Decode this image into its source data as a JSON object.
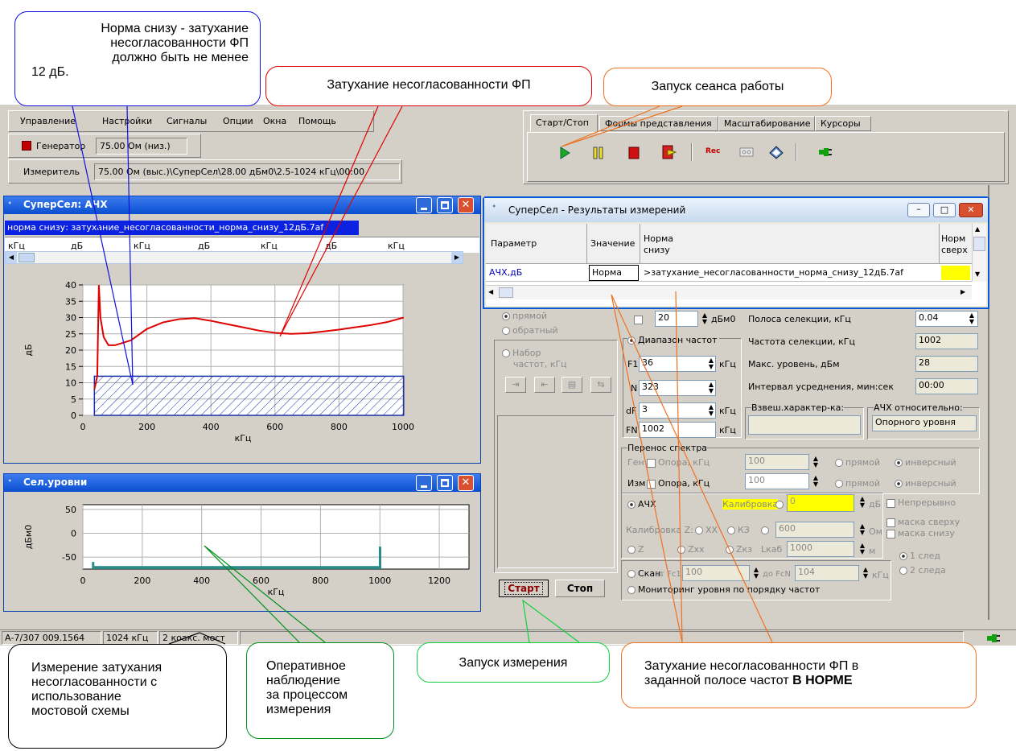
{
  "callouts": {
    "norm_below": [
      "Норма снизу - затухание",
      "несогласованности ФП",
      "должно быть не менее",
      "12 дБ."
    ],
    "attenuation": "Затухание несогласованности ФП",
    "session_start": "Запуск сеанса работы",
    "bridge_measure": [
      "Измерение затухания",
      "несогласованности с",
      "использование",
      "мостовой схемы"
    ],
    "observation": [
      "Оперативное",
      "наблюдение",
      "за процессом",
      "измерения"
    ],
    "measure_start": "Запуск измерения",
    "in_norm_prefix": "Затухание несогласованности ФП в",
    "in_norm_mid": "заданной полосе частот ",
    "in_norm_bold": "В НОРМЕ"
  },
  "menu": [
    "Управление",
    "Настройки",
    "Сигналы",
    "Опции",
    "Окна",
    "Помощь"
  ],
  "generator": {
    "label": "Генератор",
    "value": "75.00 Ом (низ.)"
  },
  "meter": {
    "label": "Измеритель",
    "value": "75.00 Ом (выс.)\\СуперСел\\28.00 дБм0\\2.5-1024 кГц\\00:00"
  },
  "tabs": [
    "Старт/Стоп",
    "Формы представления",
    "Масштабирование",
    "Курсоры"
  ],
  "toolbar_icons": [
    "play-icon",
    "pause-icon",
    "stop-icon",
    "exit-icon",
    "record-icon",
    "tape-icon",
    "eraser-icon",
    "plug-icon"
  ],
  "rec_label": "Rec",
  "ach_window": {
    "title": "СуперСел: АЧХ",
    "selected_line": "норма снизу: затухание_несогласованности_норма_снизу_12дБ.7af",
    "scroll_headers": [
      "кГц",
      "дБ",
      "кГц",
      "дБ",
      "кГц",
      "дБ",
      "кГц"
    ],
    "ylabel": "дБ",
    "xlabel": "кГц"
  },
  "sel_window": {
    "title": "Сел.уровни",
    "ylabel": "дБм0",
    "xlabel": "кГц"
  },
  "results": {
    "title": "СуперСел - Результаты измерений",
    "col_param": "Параметр",
    "col_value": "Значение",
    "col_norm_below_1": "Норма",
    "col_norm_below_2": "снизу",
    "col_norm_above_1": "Норм",
    "col_norm_above_2": "сверх",
    "row_param": "АЧХ,дБ",
    "row_value": "Норма",
    "row_norm": ">затухание_несогласованности_норма_снизу_12дБ.7af"
  },
  "panel": {
    "direct": "прямой",
    "reverse": "обратный",
    "freq_set_1": "Набор",
    "freq_set_2": "частот, кГц",
    "level": "20",
    "level_unit": "дБм0",
    "freq_range": "Диапазон частот",
    "f1_label": "F1",
    "f1": "36",
    "n_label": "N",
    "n": "323",
    "df_label": "dF",
    "df": "3",
    "fn_label": "FN",
    "fn": "1002",
    "khz": "кГц",
    "sel_band_label": "Полоса селекции, кГц",
    "sel_band": "0.04",
    "sel_freq_label": "Частота селекции, кГц",
    "sel_freq": "1002",
    "max_level_label": "Макс. уровень, дБм",
    "max_level": "28",
    "avg_label": "Интервал усреднения, мин:сек",
    "avg": "00:00",
    "weight_label": "Взвеш.характер-ка:",
    "relative_label": "АЧХ относительно:",
    "relative_value": "Опорного уровня",
    "transfer_title": "Перенос спектра",
    "gen": "Ген",
    "meas": "Изм",
    "ref_khz": "Опора, кГц",
    "ref1": "100",
    "ref2": "100",
    "inverse": "инверсный",
    "ach": "АЧХ",
    "calibration": "Калибровка",
    "calib_value": "0",
    "db": "дБ",
    "continuous": "Непрерывно",
    "mask_above": "маска сверху",
    "mask_below": "маска снизу",
    "calib_z": "Калибровка Z:",
    "xx": "ХХ",
    "kz": "КЗ",
    "calib_z_value": "600",
    "ohm": "Ом",
    "z": "Z",
    "zxx": "Zxx",
    "zkz": "Zкз",
    "lkab": "Lкаб",
    "lkab_value": "1000",
    "m": "м",
    "trace1": "1 след",
    "trace2": "2 следа",
    "scan": "Скан.",
    "from_fc1": "от Fc1",
    "fc1": "100",
    "to_fcn": "до FcN",
    "fcn": "104",
    "monitoring": "Мониторинг  уровня по порядку частот",
    "start": "Старт",
    "stop": "Стоп"
  },
  "status": [
    "А-7/307 009.1564",
    "1024 кГц",
    "2 коакс. мост"
  ],
  "chart_data": [
    {
      "type": "line",
      "title": "",
      "xlabel": "кГц",
      "ylabel": "дБ",
      "xlim": [
        0,
        1000
      ],
      "ylim": [
        0,
        40
      ],
      "xticks": [
        0,
        200,
        400,
        600,
        800,
        1000
      ],
      "yticks": [
        0,
        5,
        10,
        15,
        20,
        25,
        30,
        35,
        40
      ],
      "grid": true,
      "series": [
        {
          "name": "",
          "color": "#e00000",
          "x": [
            36,
            45,
            50,
            55,
            65,
            80,
            100,
            150,
            200,
            250,
            300,
            350,
            400,
            450,
            500,
            550,
            600,
            650,
            700,
            750,
            800,
            850,
            900,
            950,
            1002
          ],
          "y": [
            8,
            12,
            40,
            30,
            24,
            21.5,
            21.5,
            23,
            26.5,
            28.5,
            29.5,
            29.8,
            29,
            28,
            27,
            26,
            25.3,
            25,
            25.2,
            25.7,
            26.3,
            27,
            27.7,
            28.6,
            30
          ]
        }
      ],
      "norm_below": {
        "x": [
          36,
          1002
        ],
        "y": 12,
        "color": "#1a2fa8"
      }
    },
    {
      "type": "bar",
      "title": "",
      "xlabel": "кГц",
      "ylabel": "дБм0",
      "xlim": [
        0,
        1300
      ],
      "ylim": [
        -75,
        60
      ],
      "xticks": [
        0,
        200,
        400,
        600,
        800,
        1000,
        1200
      ],
      "yticks": [
        50,
        0,
        -50
      ],
      "grid": true,
      "color": "#2a8a8a",
      "baseline": -72,
      "x": [
        36,
        1002
      ],
      "values": [
        -60,
        -28
      ]
    }
  ]
}
